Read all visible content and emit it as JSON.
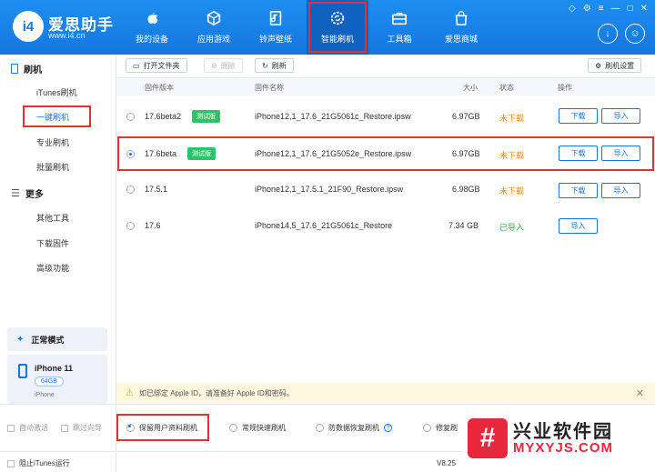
{
  "header": {
    "brand_name": "爱思助手",
    "brand_url": "www.i4.cn",
    "logo_text": "i4",
    "nav": [
      {
        "label": "我的设备",
        "icon": "apple-icon"
      },
      {
        "label": "应用游戏",
        "icon": "cube-icon"
      },
      {
        "label": "铃声壁纸",
        "icon": "music-file-icon"
      },
      {
        "label": "智能刷机",
        "icon": "refresh-gear-icon",
        "active": true
      },
      {
        "label": "工具箱",
        "icon": "toolbox-icon"
      },
      {
        "label": "爱思商城",
        "icon": "shopping-bag-icon"
      }
    ]
  },
  "sidebar": {
    "section1": "刷机",
    "items1": [
      "iTunes刷机",
      "一键刷机",
      "专业刷机",
      "批量刷机"
    ],
    "section2": "更多",
    "items2": [
      "其他工具",
      "下载固件",
      "高级功能"
    ],
    "mode": "正常模式",
    "device": {
      "name": "iPhone 11",
      "capacity": "64GB",
      "type": "iPhone"
    }
  },
  "toolbar": {
    "open_folder": "打开文件夹",
    "delete": "删除",
    "refresh": "刷新",
    "settings": "刷机设置"
  },
  "table": {
    "headers": [
      "固件版本",
      "固件名称",
      "大小",
      "状态",
      "操作"
    ],
    "rows": [
      {
        "version": "17.6beta2",
        "tag": "测试版",
        "name": "iPhone12,1_17.6_21G5061c_Restore.ipsw",
        "size": "6.97GB",
        "status": "未下载",
        "status_color": "#f08a00",
        "actions": [
          "下载",
          "导入"
        ],
        "selected": false
      },
      {
        "version": "17.6beta",
        "tag": "测试版",
        "name": "iPhone12,1_17.6_21G5052e_Restore.ipsw",
        "size": "6.97GB",
        "status": "未下载",
        "status_color": "#f08a00",
        "actions": [
          "下载",
          "导入"
        ],
        "selected": true
      },
      {
        "version": "17.5.1",
        "tag": "",
        "name": "iPhone12,1_17.5.1_21F90_Restore.ipsw",
        "size": "6.98GB",
        "status": "未下载",
        "status_color": "#f08a00",
        "actions": [
          "下载",
          "导入"
        ],
        "selected": false
      },
      {
        "version": "17.6",
        "tag": "",
        "name": "iPhone14,5_17.6_21G5061c_Restore",
        "size": "7.34 GB",
        "status": "已导入",
        "status_color": "#2bb14f",
        "actions": [
          "导入"
        ],
        "selected": false
      }
    ]
  },
  "notice": "如已绑定 Apple ID，请准备好 Apple ID和密码。",
  "options": {
    "auto_activate": "自动激活",
    "skip_guide": "跳过向导",
    "keep_data": "保留用户资料刷机",
    "quick_flash": "常规快速刷机",
    "anti_recovery": "防数据恢复刷机",
    "repair_flash": "修复刷"
  },
  "statusbar": {
    "block_itunes": "阻止iTunes运行",
    "version": "V8.25"
  },
  "watermark": {
    "cn": "兴业软件园",
    "en": "MYXYJS.COM",
    "mark": "#"
  },
  "colors": {
    "brand_blue": "#1577e0",
    "highlight_red": "#e83030",
    "tag_green": "#2cc46a"
  }
}
